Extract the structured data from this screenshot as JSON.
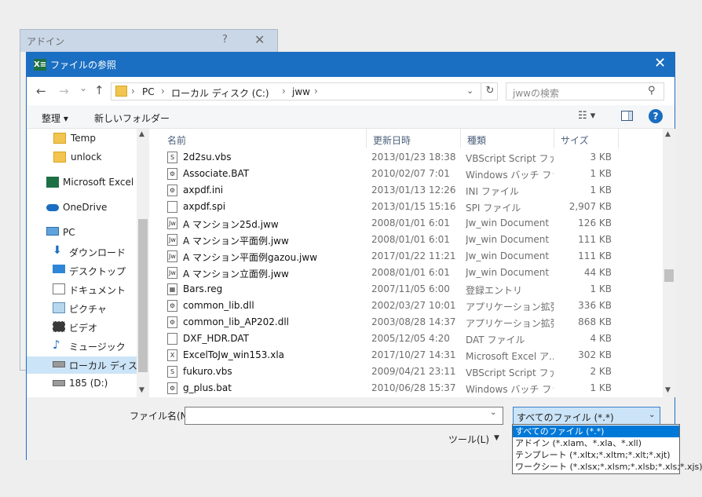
{
  "back_window": {
    "title": "アドイン",
    "help": "?",
    "close": "✕"
  },
  "window": {
    "title": "ファイルの参照",
    "app_icon": "X≡",
    "close": "✕"
  },
  "nav": {
    "back": "←",
    "forward": "→",
    "history": "⌄",
    "up": "↑",
    "breadcrumb": [
      "PC",
      "ローカル ディスク (C:)",
      "jww"
    ],
    "search_placeholder": "jwwの検索"
  },
  "commands": {
    "organize": "整理 ▾",
    "new_folder": "新しいフォルダー",
    "view": "☷ ▾",
    "help": "?"
  },
  "sidebar": {
    "items": [
      {
        "label": "Temp",
        "icon": "folder-icon"
      },
      {
        "label": "unlock",
        "icon": "folder-icon"
      },
      {
        "label": "Microsoft Excel",
        "icon": "excel-icon"
      },
      {
        "label": "OneDrive",
        "icon": "cloud-icon"
      },
      {
        "label": "PC",
        "icon": "pc-icon"
      },
      {
        "label": "ダウンロード",
        "icon": "download-icon"
      },
      {
        "label": "デスクトップ",
        "icon": "desktop-icon"
      },
      {
        "label": "ドキュメント",
        "icon": "document-icon"
      },
      {
        "label": "ピクチャ",
        "icon": "picture-icon"
      },
      {
        "label": "ビデオ",
        "icon": "video-icon"
      },
      {
        "label": "ミュージック",
        "icon": "music-icon"
      },
      {
        "label": "ローカル ディスク (C",
        "icon": "drive-icon"
      },
      {
        "label": "185 (D:)",
        "icon": "drive-icon"
      }
    ]
  },
  "columns": {
    "name": "名前",
    "date": "更新日時",
    "type": "種類",
    "size": "サイズ"
  },
  "files": [
    {
      "name": "2d2su.vbs",
      "date": "2013/01/23 18:38",
      "type": "VBScript Script ファ...",
      "size": "3 KB",
      "icon": "S"
    },
    {
      "name": "Associate.BAT",
      "date": "2010/02/07 7:01",
      "type": "Windows バッチ ファ...",
      "size": "1 KB",
      "icon": "⚙"
    },
    {
      "name": "axpdf.ini",
      "date": "2013/01/13 12:26",
      "type": "INI ファイル",
      "size": "1 KB",
      "icon": "⚙"
    },
    {
      "name": "axpdf.spi",
      "date": "2013/01/15 15:16",
      "type": "SPI ファイル",
      "size": "2,907 KB",
      "icon": ""
    },
    {
      "name": "A マンション25d.jww",
      "date": "2008/01/01 6:01",
      "type": "Jw_win Document",
      "size": "126 KB",
      "icon": "Jw"
    },
    {
      "name": "A マンション平面例.jww",
      "date": "2008/01/01 6:01",
      "type": "Jw_win Document",
      "size": "111 KB",
      "icon": "Jw"
    },
    {
      "name": "A マンション平面例gazou.jww",
      "date": "2017/01/22 11:21",
      "type": "Jw_win Document",
      "size": "111 KB",
      "icon": "Jw"
    },
    {
      "name": "A マンション立面例.jww",
      "date": "2008/01/01 6:01",
      "type": "Jw_win Document",
      "size": "44 KB",
      "icon": "Jw"
    },
    {
      "name": "Bars.reg",
      "date": "2007/11/05 6:00",
      "type": "登録エントリ",
      "size": "1 KB",
      "icon": "▦"
    },
    {
      "name": "common_lib.dll",
      "date": "2002/03/27 10:01",
      "type": "アプリケーション拡張",
      "size": "336 KB",
      "icon": "⚙"
    },
    {
      "name": "common_lib_AP202.dll",
      "date": "2003/08/28 14:37",
      "type": "アプリケーション拡張",
      "size": "868 KB",
      "icon": "⚙"
    },
    {
      "name": "DXF_HDR.DAT",
      "date": "2005/12/05 4:20",
      "type": "DAT ファイル",
      "size": "4 KB",
      "icon": ""
    },
    {
      "name": "ExcelToJw_win153.xla",
      "date": "2017/10/27 14:31",
      "type": "Microsoft Excel ア...",
      "size": "302 KB",
      "icon": "X"
    },
    {
      "name": "fukuro.vbs",
      "date": "2009/04/21 23:11",
      "type": "VBScript Script ファ...",
      "size": "2 KB",
      "icon": "S"
    },
    {
      "name": "g_plus.bat",
      "date": "2010/06/28 15:37",
      "type": "Windows バッチ ファ...",
      "size": "1 KB",
      "icon": "⚙"
    }
  ],
  "bottom": {
    "filename_label": "ファイル名(N):",
    "filename_value": "",
    "filetype_selected": "すべてのファイル (*.*)",
    "tools_label": "ツール(L)",
    "filetype_options": [
      "すべてのファイル (*.*)",
      "アドイン (*.xlam、*.xla、*.xll)",
      "テンプレート (*.xltx;*.xltm;*.xlt;*.xjt)",
      "ワークシート (*.xlsx;*.xlsm;*.xlsb;*.xls;*.xjs)"
    ]
  },
  "colors": {
    "title_bar": "#1b6fc2",
    "selection": "#cce4f7",
    "dropdown_highlight": "#0078d7"
  }
}
